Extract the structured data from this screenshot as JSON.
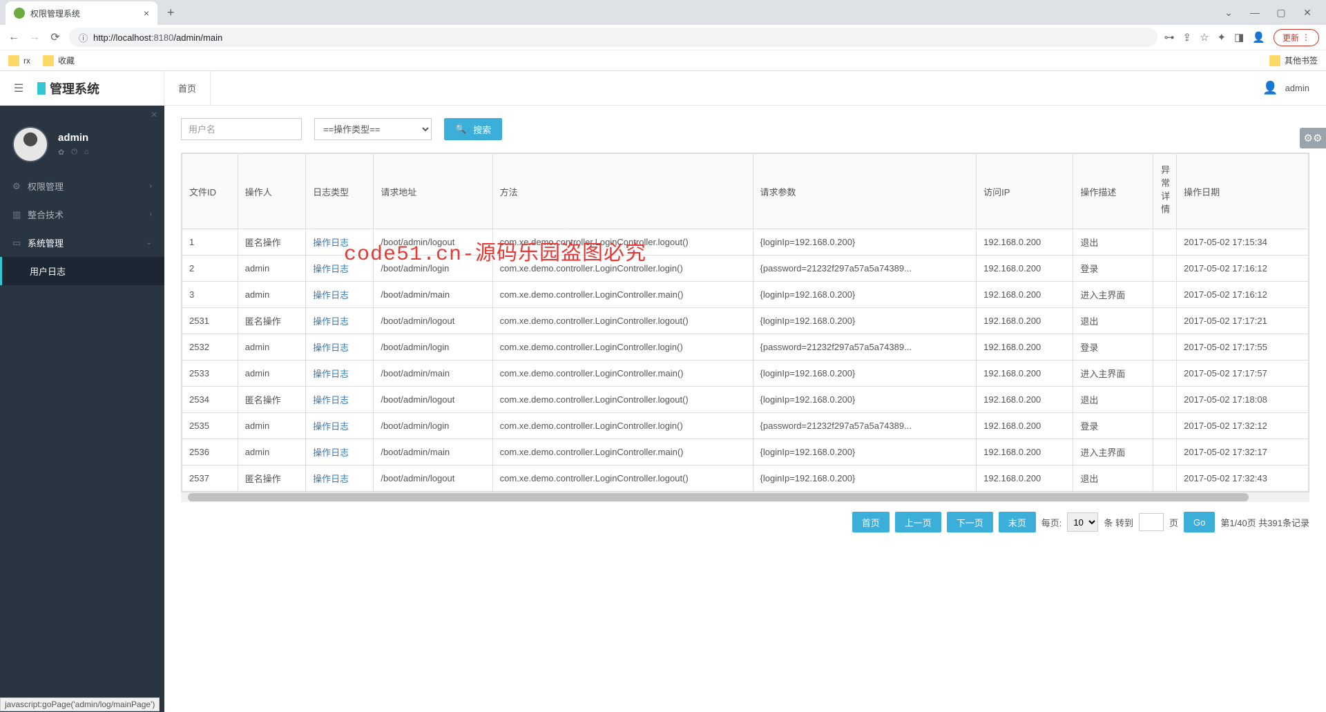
{
  "browser": {
    "tab_title": "权限管理系统",
    "url_prefix_icon": "ⓘ",
    "url_host": "http://localhost",
    "url_port": ":8180",
    "url_path": "/admin/main",
    "update_label": "更新",
    "bookmarks": [
      "rx",
      "收藏"
    ],
    "other_bookmarks": "其他书签"
  },
  "brand": "管理系统",
  "topbar": {
    "home_tab": "首页",
    "user": "admin"
  },
  "sidebar": {
    "user": "admin",
    "items": [
      {
        "icon": "⚙",
        "label": "权限管理",
        "chev": "›"
      },
      {
        "icon": "▥",
        "label": "整合技术",
        "chev": "›"
      },
      {
        "icon": "▭",
        "label": "系统管理",
        "chev": "⌄",
        "open": true,
        "children": [
          "用户日志"
        ]
      }
    ]
  },
  "filters": {
    "user_placeholder": "用户名",
    "type_default": "==操作类型==",
    "search_label": "搜索"
  },
  "columns": [
    "文件ID",
    "操作人",
    "日志类型",
    "请求地址",
    "方法",
    "请求参数",
    "访问IP",
    "操作描述",
    "异常详情",
    "操作日期"
  ],
  "log_type_link": "操作日志",
  "rows": [
    {
      "id": "1",
      "op": "匿名操作",
      "url": "/boot/admin/logout",
      "method": "com.xe.demo.controller.LoginController.logout()",
      "params": "{loginIp=192.168.0.200}",
      "ip": "192.168.0.200",
      "desc": "退出",
      "date": "2017-05-02 17:15:34"
    },
    {
      "id": "2",
      "op": "admin",
      "url": "/boot/admin/login",
      "method": "com.xe.demo.controller.LoginController.login()",
      "params": "{password=21232f297a57a5a74389...",
      "ip": "192.168.0.200",
      "desc": "登录",
      "date": "2017-05-02 17:16:12"
    },
    {
      "id": "3",
      "op": "admin",
      "url": "/boot/admin/main",
      "method": "com.xe.demo.controller.LoginController.main()",
      "params": "{loginIp=192.168.0.200}",
      "ip": "192.168.0.200",
      "desc": "进入主界面",
      "date": "2017-05-02 17:16:12"
    },
    {
      "id": "2531",
      "op": "匿名操作",
      "url": "/boot/admin/logout",
      "method": "com.xe.demo.controller.LoginController.logout()",
      "params": "{loginIp=192.168.0.200}",
      "ip": "192.168.0.200",
      "desc": "退出",
      "date": "2017-05-02 17:17:21"
    },
    {
      "id": "2532",
      "op": "admin",
      "url": "/boot/admin/login",
      "method": "com.xe.demo.controller.LoginController.login()",
      "params": "{password=21232f297a57a5a74389...",
      "ip": "192.168.0.200",
      "desc": "登录",
      "date": "2017-05-02 17:17:55"
    },
    {
      "id": "2533",
      "op": "admin",
      "url": "/boot/admin/main",
      "method": "com.xe.demo.controller.LoginController.main()",
      "params": "{loginIp=192.168.0.200}",
      "ip": "192.168.0.200",
      "desc": "进入主界面",
      "date": "2017-05-02 17:17:57"
    },
    {
      "id": "2534",
      "op": "匿名操作",
      "url": "/boot/admin/logout",
      "method": "com.xe.demo.controller.LoginController.logout()",
      "params": "{loginIp=192.168.0.200}",
      "ip": "192.168.0.200",
      "desc": "退出",
      "date": "2017-05-02 17:18:08"
    },
    {
      "id": "2535",
      "op": "admin",
      "url": "/boot/admin/login",
      "method": "com.xe.demo.controller.LoginController.login()",
      "params": "{password=21232f297a57a5a74389...",
      "ip": "192.168.0.200",
      "desc": "登录",
      "date": "2017-05-02 17:32:12"
    },
    {
      "id": "2536",
      "op": "admin",
      "url": "/boot/admin/main",
      "method": "com.xe.demo.controller.LoginController.main()",
      "params": "{loginIp=192.168.0.200}",
      "ip": "192.168.0.200",
      "desc": "进入主界面",
      "date": "2017-05-02 17:32:17"
    },
    {
      "id": "2537",
      "op": "匿名操作",
      "url": "/boot/admin/logout",
      "method": "com.xe.demo.controller.LoginController.logout()",
      "params": "{loginIp=192.168.0.200}",
      "ip": "192.168.0.200",
      "desc": "退出",
      "date": "2017-05-02 17:32:43"
    }
  ],
  "pager": {
    "first": "首页",
    "prev": "上一页",
    "next": "下一页",
    "last": "末页",
    "per_label": "每页:",
    "per_value": "10",
    "per_suffix": "条 转到",
    "page_suffix": "页",
    "go": "Go",
    "info": "第1/40页 共391条记录"
  },
  "status_bar": "javascript:goPage('admin/log/mainPage')",
  "watermark": "code51.cn-源码乐园盗图必究"
}
